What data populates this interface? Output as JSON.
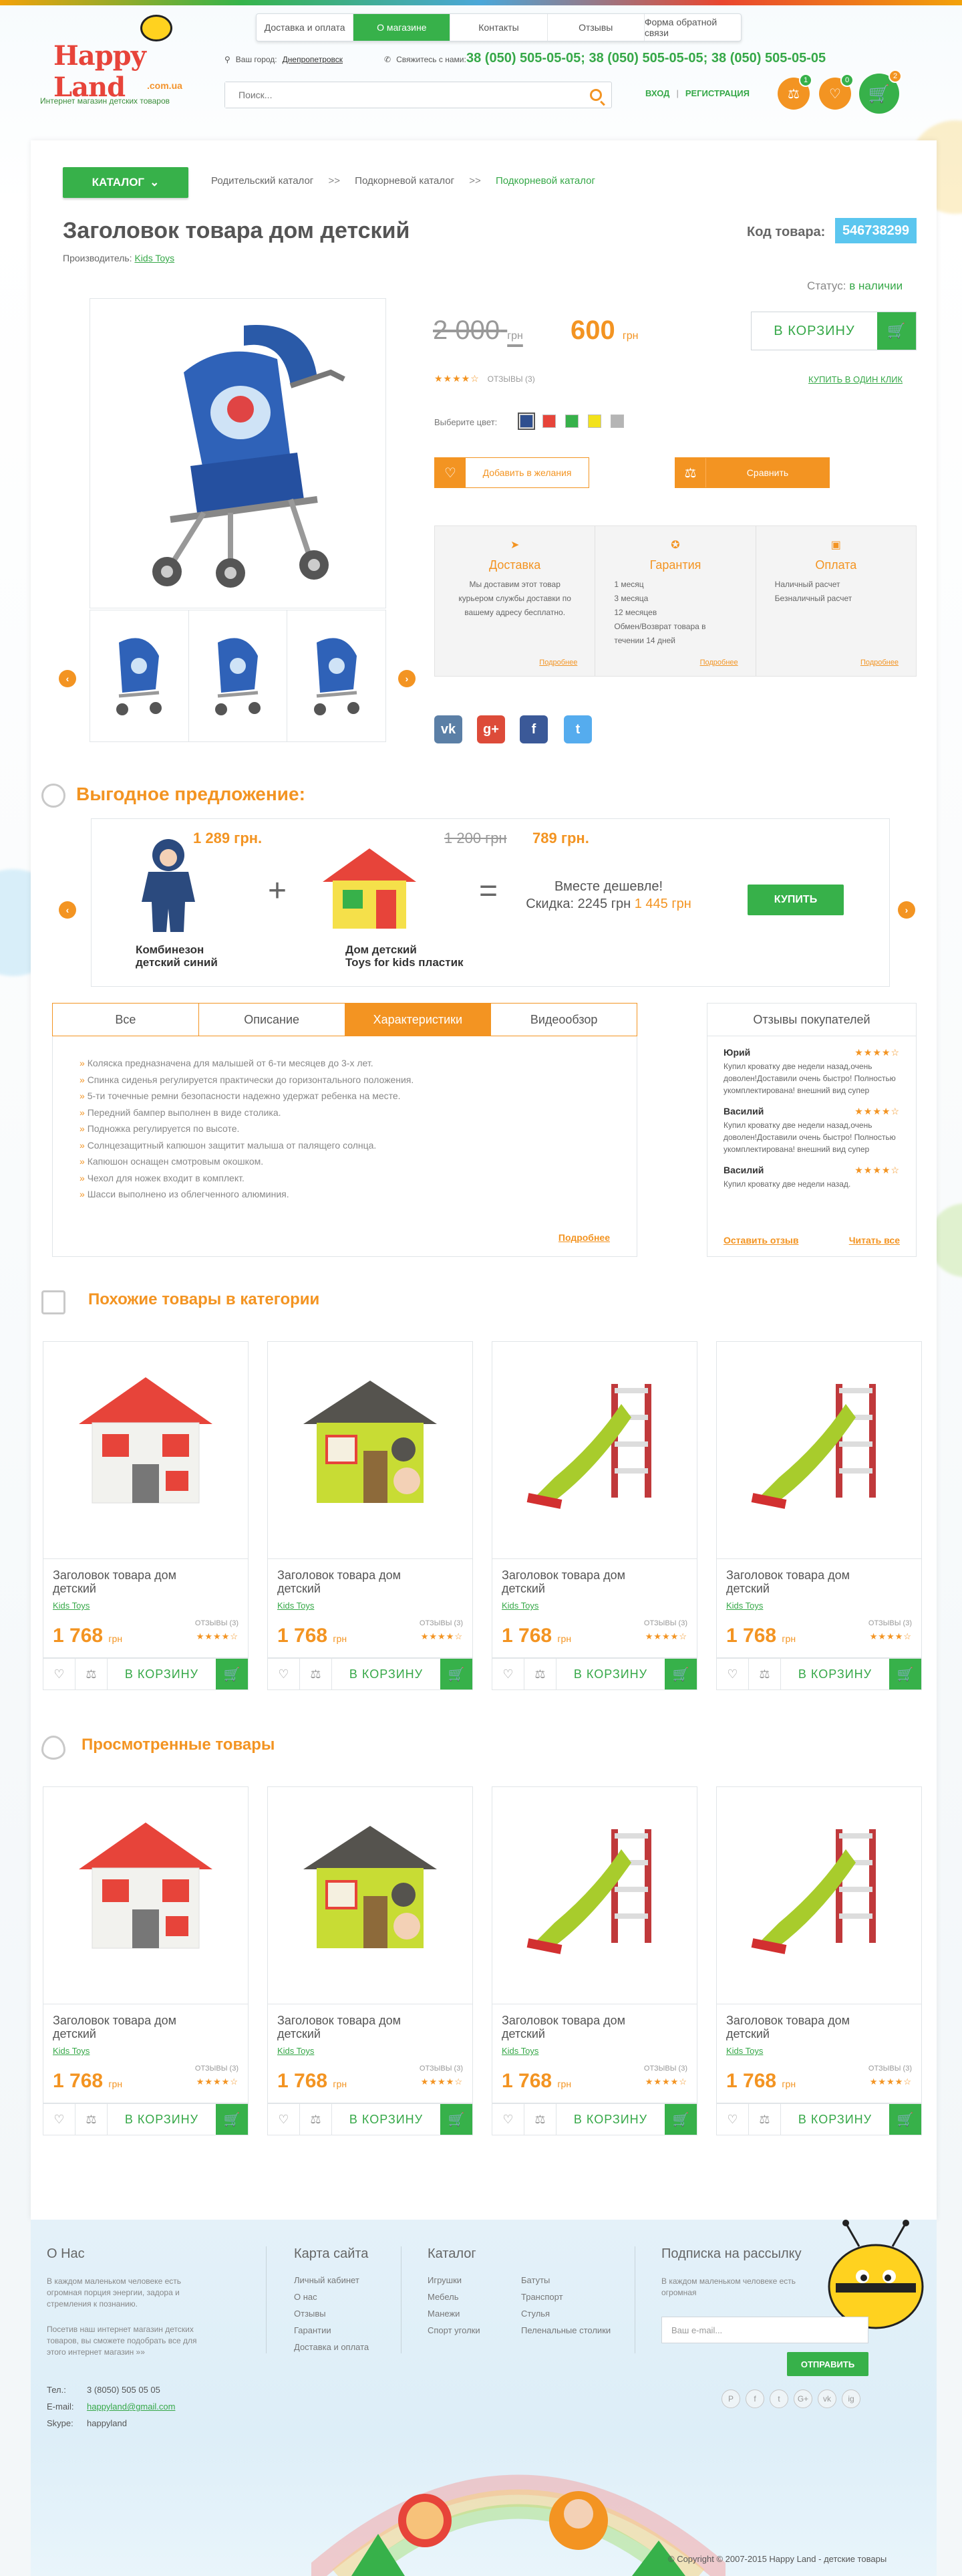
{
  "header": {
    "logo_text": "Happy Land",
    "logo_domain": ".com.ua",
    "tagline": "Интернет магазин детских товаров",
    "nav": [
      "Доставка и оплата",
      "О магазине",
      "Контакты",
      "Отзывы",
      "Форма обратной связи"
    ],
    "city_label": "Ваш город:",
    "city": "Днепропетровск",
    "contact_label": "Свяжитесь с нами:",
    "phones": "38 (050) 505-05-05;  38 (050) 505-05-05;  38 (050) 505-05-05",
    "search_placeholder": "Поиск...",
    "login": "ВХОД",
    "register": "РЕГИСТРАЦИЯ",
    "compare_count": "1",
    "wishlist_count": "0",
    "cart_count": "2"
  },
  "breadcrumb": {
    "catalog_button": "КАТАЛОГ",
    "items": [
      "Родительский каталог",
      "Подкорневой каталог",
      "Подкорневой каталог"
    ],
    "separator": ">>"
  },
  "product": {
    "title": "Заголовок товара дом детский",
    "maker_label": "Производитель:",
    "maker": "Kids Toys",
    "code_label": "Код товара:",
    "code": "546738299",
    "status_label": "Статус:",
    "status": "в наличии",
    "old_price": "2 000",
    "new_price": "600",
    "currency": "грн",
    "buy_label": "В КОРЗИНУ",
    "stars": "★★★★☆",
    "reviews": "ОТЗЫВЫ (3)",
    "one_click": "КУПИТЬ В ОДИН КЛИК",
    "color_label": "Выберите цвет:",
    "colors": [
      "#2f4f8f",
      "#e7443a",
      "#37b14a",
      "#f2e21b",
      "#b5b5b5"
    ],
    "wishlist_label": "Добавить в желания",
    "compare_label": "Сравнить",
    "info": [
      {
        "title": "Доставка",
        "text": "Мы доставим этот товар курьером службы доставки по вашему адресу бесплатно.",
        "more": "Подробнее"
      },
      {
        "title": "Гарантия",
        "text": "1 месяц\n3 месяца\n12 месяцев\nОбмен/Возврат товара в течении 14 дней",
        "more": "Подробнее"
      },
      {
        "title": "Оплата",
        "text": "Наличный расчет\nБезналичный расчет",
        "more": "Подробнее"
      }
    ]
  },
  "offer": {
    "heading": "Выгодное предложение:",
    "item1": {
      "name": "Комбинезон\nдетский синий",
      "price": "1 289 грн."
    },
    "item2": {
      "name": "Дом детский\nToys for kids пластик",
      "old_price": "1 200 грн",
      "price": "789 грн."
    },
    "together_line1": "Вместе дешевле!",
    "together_line2": "Скидка: 2245 грн",
    "together_price": "1 445 грн",
    "buy_label": "КУПИТЬ"
  },
  "tabs": {
    "items": [
      "Все",
      "Описание",
      "Характеристики",
      "Видеообзор"
    ],
    "active_index": 2,
    "characteristics": [
      "Коляска предназначена для малышей от 6-ти месяцев до 3-х лет.",
      "Спинка сиденья регулируется практически до горизонтального положения.",
      "5-ти точечные ремни безопасности надежно удержат ребенка на месте.",
      "Передний бампер выполнен в виде столика.",
      "Подножка регулируется по высоте.",
      "Солнцезащитный капюшон защитит малыша от палящего солнца.",
      "Капюшон оснащен смотровым окошком.",
      "Чехол для ножек входит в комплект.",
      "Шасси выполнено из облегченного алюминия."
    ],
    "more": "Подробнее"
  },
  "reviews": {
    "heading": "Отзывы покупателей",
    "items": [
      {
        "name": "Юрий",
        "stars": "★★★★☆",
        "text": "Купил кроватку две недели назад,очень доволен!Доставили очень быстро! Полностью укомплектирована! внешний вид супер"
      },
      {
        "name": "Василий",
        "stars": "★★★★☆",
        "text": "Купил кроватку две недели назад,очень доволен!Доставили очень быстро! Полностью укомплектирована! внешний вид супер"
      },
      {
        "name": "Василий",
        "stars": "★★★★☆",
        "text": "Купил кроватку две недели назад."
      }
    ],
    "leave": "Оставить отзыв",
    "read_all": "Читать все"
  },
  "similar": {
    "heading": "Похожие товары в категории",
    "products": [
      {
        "name": "Заголовок товара дом детский",
        "maker": "Kids Toys",
        "price": "1 768",
        "currency": "грн",
        "reviews": "ОТЗЫВЫ (3)",
        "stars": "★★★★☆",
        "buy": "В КОРЗИНУ",
        "kind": "house-red"
      },
      {
        "name": "Заголовок товара дом детский",
        "maker": "Kids Toys",
        "price": "1 768",
        "currency": "грн",
        "reviews": "ОТЗЫВЫ (3)",
        "stars": "★★★★☆",
        "buy": "В КОРЗИНУ",
        "kind": "house-green"
      },
      {
        "name": "Заголовок товара дом детский",
        "maker": "Kids Toys",
        "price": "1 768",
        "currency": "грн",
        "reviews": "ОТЗЫВЫ (3)",
        "stars": "★★★★☆",
        "buy": "В КОРЗИНУ",
        "kind": "slide"
      },
      {
        "name": "Заголовок товара дом детский",
        "maker": "Kids Toys",
        "price": "1 768",
        "currency": "грн",
        "reviews": "ОТЗЫВЫ (3)",
        "stars": "★★★★☆",
        "buy": "В КОРЗИНУ",
        "kind": "slide"
      }
    ]
  },
  "viewed": {
    "heading": "Просмотренные товары",
    "products": [
      {
        "name": "Заголовок товара дом детский",
        "maker": "Kids Toys",
        "price": "1 768",
        "currency": "грн",
        "reviews": "ОТЗЫВЫ (3)",
        "stars": "★★★★☆",
        "buy": "В КОРЗИНУ",
        "kind": "house-red"
      },
      {
        "name": "Заголовок товара дом детский",
        "maker": "Kids Toys",
        "price": "1 768",
        "currency": "грн",
        "reviews": "ОТЗЫВЫ (3)",
        "stars": "★★★★☆",
        "buy": "В КОРЗИНУ",
        "kind": "house-green"
      },
      {
        "name": "Заголовок товара дом детский",
        "maker": "Kids Toys",
        "price": "1 768",
        "currency": "грн",
        "reviews": "ОТЗЫВЫ (3)",
        "stars": "★★★★☆",
        "buy": "В КОРЗИНУ",
        "kind": "slide"
      },
      {
        "name": "Заголовок товара дом детский",
        "maker": "Kids Toys",
        "price": "1 768",
        "currency": "грн",
        "reviews": "ОТЗЫВЫ (3)",
        "stars": "★★★★☆",
        "buy": "В КОРЗИНУ",
        "kind": "slide"
      }
    ]
  },
  "footer": {
    "about_title": "О Нас",
    "about_text1": "В каждом маленьком человеке есть огромная порция энергии, задора и стремления к познанию.",
    "about_text2": "Посетив наш интернет магазин детских товаров, вы сможете подобрать все для этого интернет магазин »»",
    "sitemap_title": "Карта сайта",
    "sitemap": [
      "Личный кабинет",
      "О нас",
      "Отзывы",
      "Гарантии",
      "Доставка и оплата"
    ],
    "catalog_title": "Каталог",
    "catalog_col1": [
      "Игрушки",
      "Мебель",
      "Манежи",
      "Спорт уголки"
    ],
    "catalog_col2": [
      "Батуты",
      "Транспорт",
      "Стулья",
      "Пеленальные столики"
    ],
    "subscribe_title": "Подписка на рассылку",
    "subscribe_text": "В каждом маленьком человеке есть огромная",
    "email_placeholder": "Ваш e-mail...",
    "subscribe_button": "ОТПРАВИТЬ",
    "tel_label": "Тел.:",
    "tel": "3 (8050) 505 05 05",
    "email_label": "E-mail:",
    "email": "happyland@gmail.com",
    "skype_label": "Skype:",
    "skype": "happyland",
    "copyright": "© Copyright © 2007-2015 Happy Land - детские товары",
    "socials": [
      "P",
      "f",
      "t",
      "G+",
      "vk",
      "ig"
    ]
  }
}
